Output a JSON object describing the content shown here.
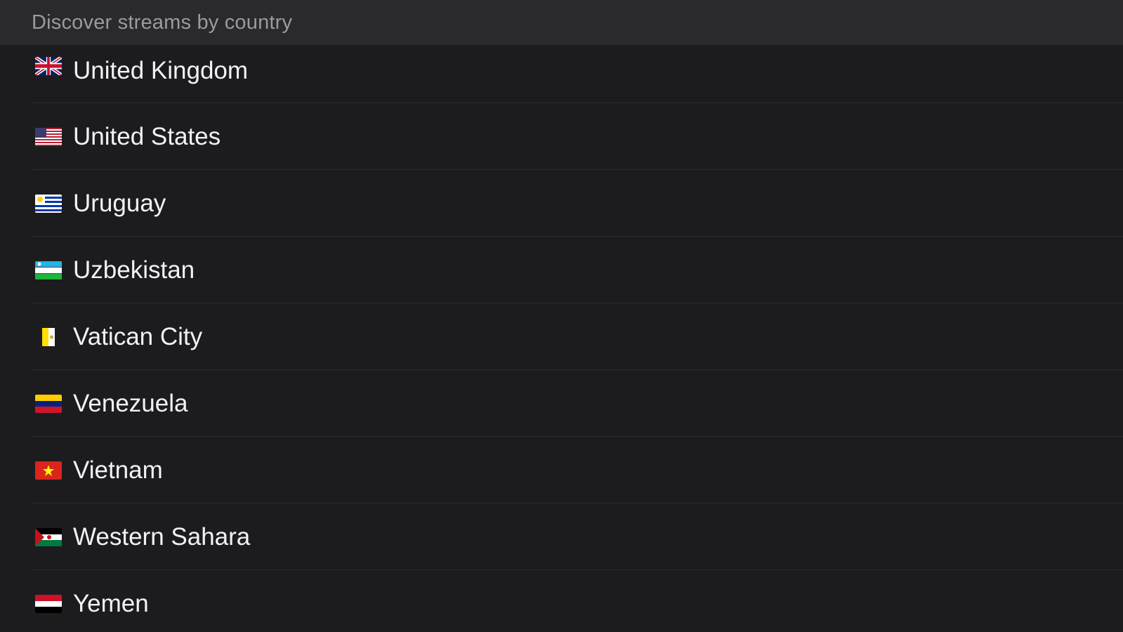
{
  "header": {
    "title": "Discover streams by country"
  },
  "countries": [
    {
      "name": "United Kingdom",
      "flag_icon": "flag-united-kingdom-icon"
    },
    {
      "name": "United States",
      "flag_icon": "flag-united-states-icon"
    },
    {
      "name": "Uruguay",
      "flag_icon": "flag-uruguay-icon"
    },
    {
      "name": "Uzbekistan",
      "flag_icon": "flag-uzbekistan-icon"
    },
    {
      "name": "Vatican City",
      "flag_icon": "flag-vatican-city-icon"
    },
    {
      "name": "Venezuela",
      "flag_icon": "flag-venezuela-icon"
    },
    {
      "name": "Vietnam",
      "flag_icon": "flag-vietnam-icon"
    },
    {
      "name": "Western Sahara",
      "flag_icon": "flag-western-sahara-icon"
    },
    {
      "name": "Yemen",
      "flag_icon": "flag-yemen-icon"
    }
  ],
  "colors": {
    "background": "#1c1c1e",
    "header_background": "#2a2a2c",
    "header_text": "#9a9a9f",
    "row_text": "#f2f2f4",
    "separator": "#2c2c2f"
  }
}
